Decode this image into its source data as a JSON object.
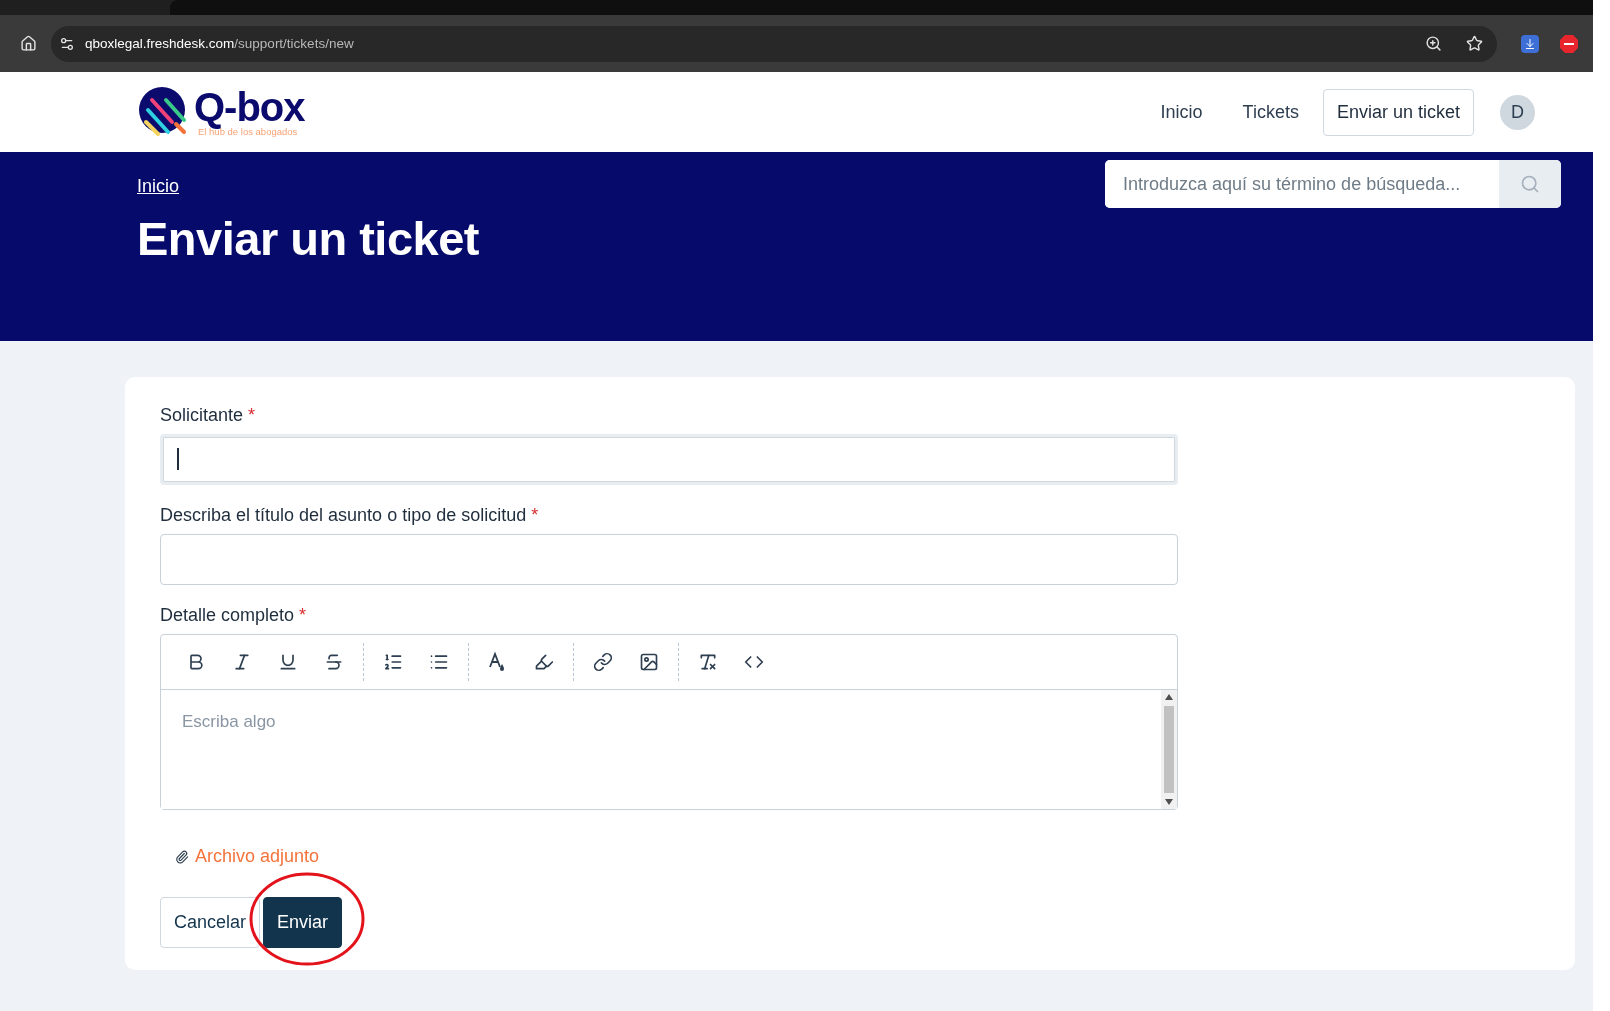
{
  "browser": {
    "url_host": "qboxlegal.freshdesk.com",
    "url_path": "/support/tickets/new"
  },
  "header": {
    "logo_text": "Q-box",
    "logo_tagline": "El hub de los abogados",
    "nav": [
      {
        "label": "Inicio",
        "kind": "link"
      },
      {
        "label": "Tickets",
        "kind": "link"
      },
      {
        "label": "Enviar un ticket",
        "kind": "button"
      }
    ],
    "avatar": "D"
  },
  "banner": {
    "breadcrumb": "Inicio",
    "title": "Enviar un ticket",
    "search": {
      "placeholder": "Introduzca aquí su término de búsqueda..."
    }
  },
  "form": {
    "fields": [
      {
        "label": "Solicitante",
        "required": "*",
        "kind": "input",
        "focused": true
      },
      {
        "label": "Describa el título del asunto o tipo de solicitud",
        "required": "*",
        "kind": "input",
        "focused": false
      },
      {
        "label": "Detalle completo",
        "required": "*",
        "kind": "editor",
        "placeholder": "Escriba algo"
      }
    ],
    "attachment": "Archivo adjunto",
    "buttons": [
      {
        "label": "Cancelar",
        "kind": "secondary"
      },
      {
        "label": "Enviar",
        "kind": "primary",
        "highlighted": true
      }
    ]
  }
}
